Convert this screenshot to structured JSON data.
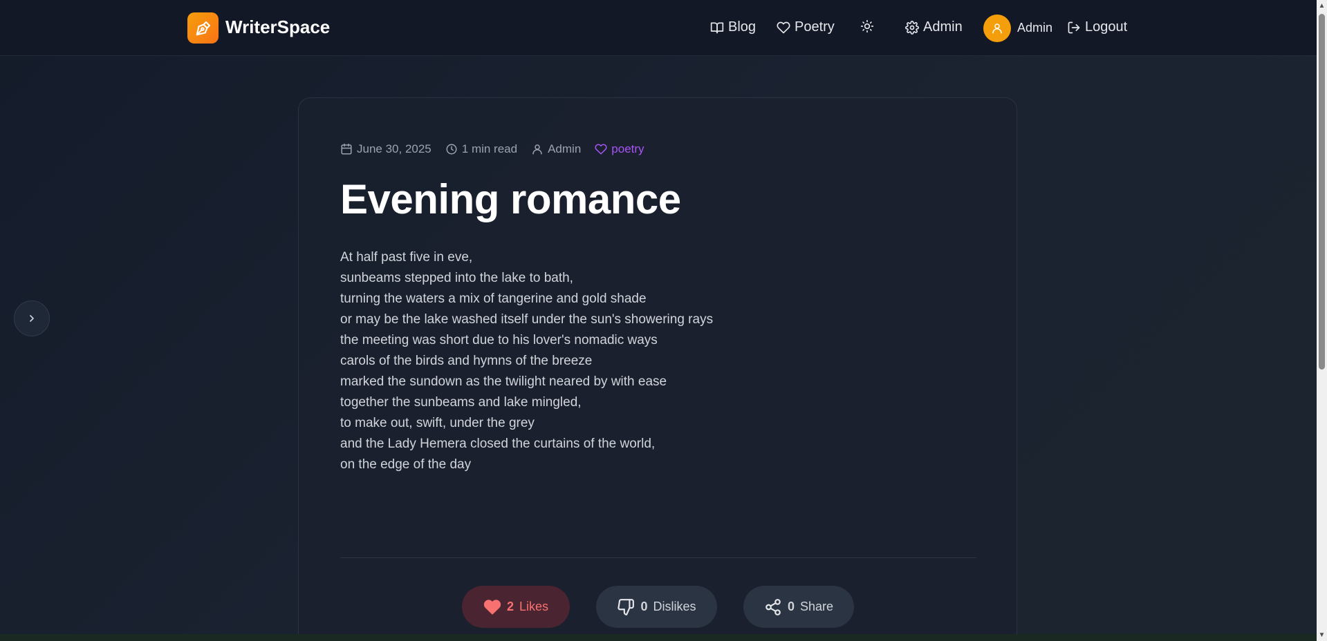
{
  "brand": {
    "name": "WriterSpace",
    "accent": "#f59e0b"
  },
  "nav": {
    "blog": "Blog",
    "poetry": "Poetry",
    "admin": "Admin",
    "user_name": "Admin",
    "logout": "Logout"
  },
  "post": {
    "date": "June 30, 2025",
    "read_time": "1 min read",
    "author": "Admin",
    "tag": "poetry",
    "title": "Evening romance",
    "lines": [
      "At half past five in eve,",
      "sunbeams stepped into the lake to bath,",
      "turning the waters a mix of tangerine and gold shade",
      "or may be the lake washed itself under the sun's showering rays",
      "the meeting was short due to his lover's nomadic ways",
      "carols of the birds and hymns of the breeze",
      "marked the sundown as the twilight neared by with ease",
      "together the sunbeams and lake mingled,",
      "to make out, swift, under the grey",
      "and the Lady Hemera closed the curtains of the world,",
      "on the edge of the day"
    ]
  },
  "actions": {
    "likes_count": "2",
    "likes_label": "Likes",
    "dislikes_count": "0",
    "dislikes_label": "Dislikes",
    "share_count": "0",
    "share_label": "Share"
  }
}
